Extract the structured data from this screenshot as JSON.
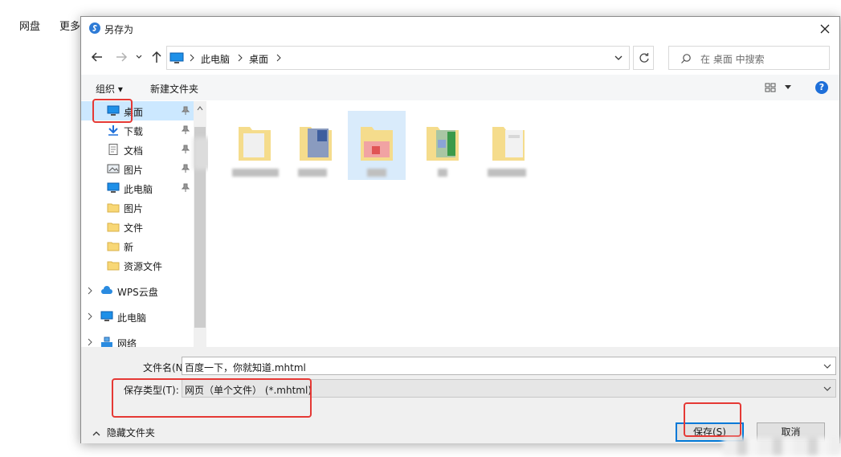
{
  "background_nav": {
    "item1": "网盘",
    "item2": "更多"
  },
  "dialog": {
    "title": "另存为",
    "address": {
      "seg1": "此电脑",
      "seg2": "桌面"
    },
    "search_placeholder": "在 桌面 中搜索",
    "toolbar": {
      "organize": "组织 ▾",
      "new_folder": "新建文件夹",
      "help": "?"
    },
    "nav_items": [
      {
        "label": "桌面",
        "icon": "desktop-icon",
        "pinned": true,
        "selected": true
      },
      {
        "label": "下载",
        "icon": "download-icon",
        "pinned": true
      },
      {
        "label": "文档",
        "icon": "document-icon",
        "pinned": true
      },
      {
        "label": "图片",
        "icon": "pictures-icon",
        "pinned": true
      },
      {
        "label": "此电脑",
        "icon": "computer-icon",
        "pinned": true
      },
      {
        "label": "图片",
        "icon": "folder-icon"
      },
      {
        "label": "文件",
        "icon": "folder-icon"
      },
      {
        "label": "新",
        "icon": "folder-icon"
      },
      {
        "label": "资源文件",
        "icon": "folder-icon"
      }
    ],
    "nav_groups": [
      {
        "label": "WPS云盘",
        "icon": "cloud-icon"
      },
      {
        "label": "此电脑",
        "icon": "computer-icon"
      },
      {
        "label": "网络",
        "icon": "network-icon"
      }
    ],
    "filename": {
      "label": "文件名(N):",
      "value": "百度一下，你就知道.mhtml"
    },
    "filetype": {
      "label": "保存类型(T):",
      "value": "网页（单个文件） (*.mhtml)"
    },
    "hide_folders": "隐藏文件夹",
    "save_button": "保存(S)",
    "cancel_button": "取消"
  },
  "colors": {
    "accent": "#0078d7",
    "highlight": "#e53935",
    "selection": "#cce8ff"
  }
}
